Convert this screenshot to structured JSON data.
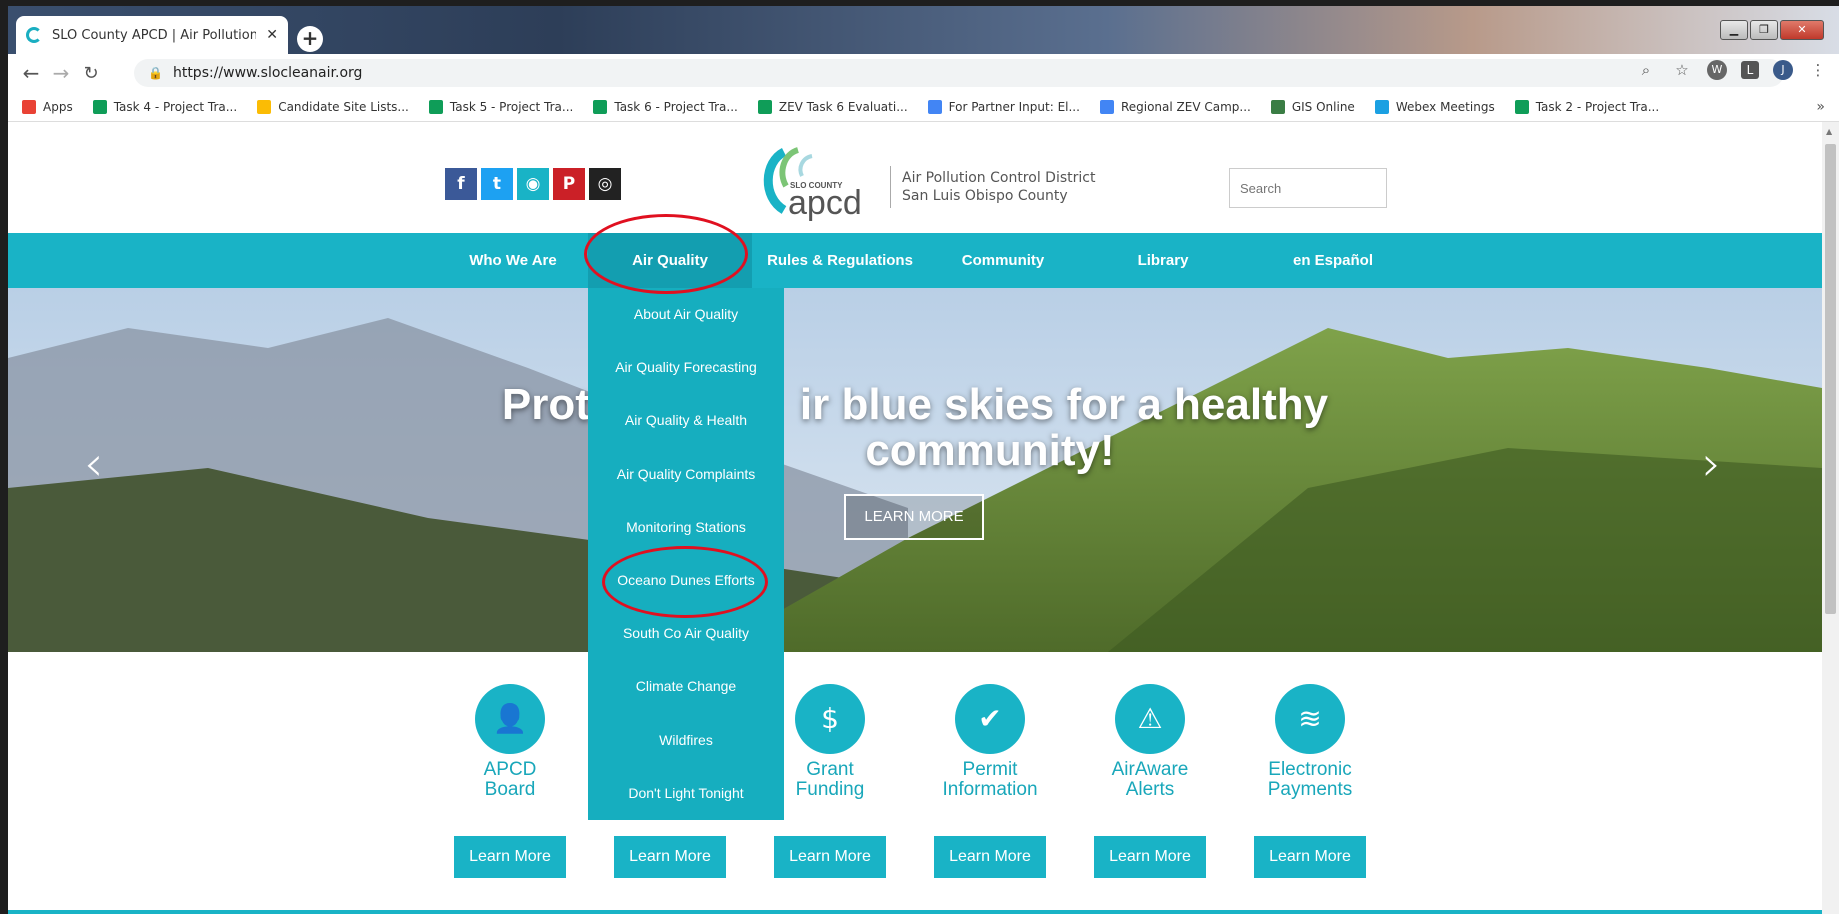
{
  "browser": {
    "tab_title": "SLO County APCD | Air Pollution",
    "tab_close": "✕",
    "new_tab": "+",
    "url": "https://www.slocleanair.org",
    "window_controls": [
      "▁",
      "❐",
      "✕"
    ],
    "profile_initial": "J",
    "ext_w": "W",
    "ext_l": "L"
  },
  "bookmarks": {
    "items": [
      {
        "label": "Apps",
        "color": "#e94235"
      },
      {
        "label": "Task 4 - Project Tra...",
        "color": "#0f9d58"
      },
      {
        "label": "Candidate Site Lists...",
        "color": "#fbbc04"
      },
      {
        "label": "Task 5 - Project Tra...",
        "color": "#0f9d58"
      },
      {
        "label": "Task 6 - Project Tra...",
        "color": "#0f9d58"
      },
      {
        "label": "ZEV Task 6 Evaluati...",
        "color": "#0f9d58"
      },
      {
        "label": "For Partner Input: El...",
        "color": "#4285f4"
      },
      {
        "label": "Regional ZEV Camp...",
        "color": "#4285f4"
      },
      {
        "label": "GIS Online",
        "color": "#3a7d44"
      },
      {
        "label": "Webex Meetings",
        "color": "#1ba0e2"
      },
      {
        "label": "Task 2 - Project Tra...",
        "color": "#0f9d58"
      }
    ],
    "more": "»"
  },
  "header": {
    "social": [
      {
        "glyph": "f",
        "color": "#3b5998"
      },
      {
        "glyph": "t",
        "color": "#1da1f2"
      },
      {
        "glyph": "◉",
        "color": "#19b3c6"
      },
      {
        "glyph": "P",
        "color": "#cb2027"
      },
      {
        "glyph": "◎",
        "color": "#222222"
      }
    ],
    "logo_small": "SLO COUNTY",
    "logo_big": "apcd",
    "org_line1": "Air Pollution Control District",
    "org_line2": "San Luis Obispo County",
    "search_placeholder": "Search"
  },
  "nav": {
    "items": [
      "Who We Are",
      "Air Quality",
      "Rules & Regulations",
      "Community",
      "Library",
      "en Español"
    ]
  },
  "dropdown": {
    "items": [
      "About Air Quality",
      "Air Quality Forecasting",
      "Air Quality & Health",
      "Air Quality Complaints",
      "Monitoring Stations",
      "Oceano Dunes Efforts",
      "South Co Air Quality",
      "Climate Change",
      "Wildfires",
      "Don't Light Tonight"
    ]
  },
  "hero": {
    "line1_left": "Prot",
    "line1_right": "ir blue skies for a healthy",
    "line2": "community!",
    "button": "LEARN MORE",
    "prev": "‹",
    "next": "›"
  },
  "services": {
    "items": [
      {
        "label1": "APCD",
        "label2": "Board",
        "icon": "👤"
      },
      {
        "label1": "Grant",
        "label2": "Funding",
        "icon": "$"
      },
      {
        "label1": "Permit",
        "label2": "Information",
        "icon": "✔"
      },
      {
        "label1": "AirAware",
        "label2": "Alerts",
        "icon": "⚠"
      },
      {
        "label1": "Electronic",
        "label2": "Payments",
        "icon": "≋"
      }
    ],
    "button_label": "Learn More"
  },
  "colors": {
    "brand": "#19b3c6",
    "brand_dark": "#139eb0",
    "highlight": "#e01020"
  }
}
